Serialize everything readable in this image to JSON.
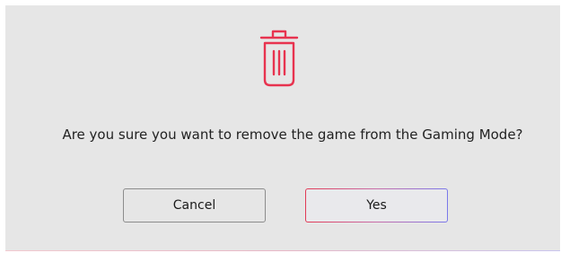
{
  "dialog": {
    "message": "Are you sure you want to remove the game from the Gaming Mode?",
    "icon": "trash-icon",
    "icon_color": "#e8334f",
    "cancel_label": "Cancel",
    "confirm_label": "Yes",
    "confirm_border_gradient": [
      "#e23a55",
      "#7a78ea"
    ]
  }
}
